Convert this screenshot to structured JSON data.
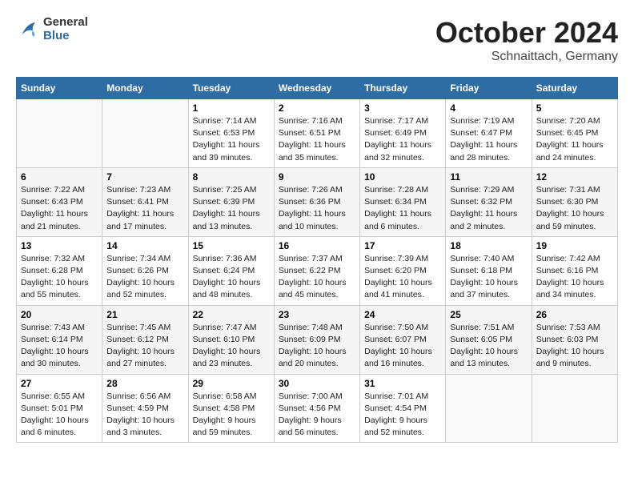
{
  "header": {
    "logo_line1": "General",
    "logo_line2": "Blue",
    "title": "October 2024",
    "subtitle": "Schnaittach, Germany"
  },
  "days_of_week": [
    "Sunday",
    "Monday",
    "Tuesday",
    "Wednesday",
    "Thursday",
    "Friday",
    "Saturday"
  ],
  "weeks": [
    {
      "days": [
        {
          "num": "",
          "info": ""
        },
        {
          "num": "",
          "info": ""
        },
        {
          "num": "1",
          "info": "Sunrise: 7:14 AM\nSunset: 6:53 PM\nDaylight: 11 hours\nand 39 minutes."
        },
        {
          "num": "2",
          "info": "Sunrise: 7:16 AM\nSunset: 6:51 PM\nDaylight: 11 hours\nand 35 minutes."
        },
        {
          "num": "3",
          "info": "Sunrise: 7:17 AM\nSunset: 6:49 PM\nDaylight: 11 hours\nand 32 minutes."
        },
        {
          "num": "4",
          "info": "Sunrise: 7:19 AM\nSunset: 6:47 PM\nDaylight: 11 hours\nand 28 minutes."
        },
        {
          "num": "5",
          "info": "Sunrise: 7:20 AM\nSunset: 6:45 PM\nDaylight: 11 hours\nand 24 minutes."
        }
      ]
    },
    {
      "days": [
        {
          "num": "6",
          "info": "Sunrise: 7:22 AM\nSunset: 6:43 PM\nDaylight: 11 hours\nand 21 minutes."
        },
        {
          "num": "7",
          "info": "Sunrise: 7:23 AM\nSunset: 6:41 PM\nDaylight: 11 hours\nand 17 minutes."
        },
        {
          "num": "8",
          "info": "Sunrise: 7:25 AM\nSunset: 6:39 PM\nDaylight: 11 hours\nand 13 minutes."
        },
        {
          "num": "9",
          "info": "Sunrise: 7:26 AM\nSunset: 6:36 PM\nDaylight: 11 hours\nand 10 minutes."
        },
        {
          "num": "10",
          "info": "Sunrise: 7:28 AM\nSunset: 6:34 PM\nDaylight: 11 hours\nand 6 minutes."
        },
        {
          "num": "11",
          "info": "Sunrise: 7:29 AM\nSunset: 6:32 PM\nDaylight: 11 hours\nand 2 minutes."
        },
        {
          "num": "12",
          "info": "Sunrise: 7:31 AM\nSunset: 6:30 PM\nDaylight: 10 hours\nand 59 minutes."
        }
      ]
    },
    {
      "days": [
        {
          "num": "13",
          "info": "Sunrise: 7:32 AM\nSunset: 6:28 PM\nDaylight: 10 hours\nand 55 minutes."
        },
        {
          "num": "14",
          "info": "Sunrise: 7:34 AM\nSunset: 6:26 PM\nDaylight: 10 hours\nand 52 minutes."
        },
        {
          "num": "15",
          "info": "Sunrise: 7:36 AM\nSunset: 6:24 PM\nDaylight: 10 hours\nand 48 minutes."
        },
        {
          "num": "16",
          "info": "Sunrise: 7:37 AM\nSunset: 6:22 PM\nDaylight: 10 hours\nand 45 minutes."
        },
        {
          "num": "17",
          "info": "Sunrise: 7:39 AM\nSunset: 6:20 PM\nDaylight: 10 hours\nand 41 minutes."
        },
        {
          "num": "18",
          "info": "Sunrise: 7:40 AM\nSunset: 6:18 PM\nDaylight: 10 hours\nand 37 minutes."
        },
        {
          "num": "19",
          "info": "Sunrise: 7:42 AM\nSunset: 6:16 PM\nDaylight: 10 hours\nand 34 minutes."
        }
      ]
    },
    {
      "days": [
        {
          "num": "20",
          "info": "Sunrise: 7:43 AM\nSunset: 6:14 PM\nDaylight: 10 hours\nand 30 minutes."
        },
        {
          "num": "21",
          "info": "Sunrise: 7:45 AM\nSunset: 6:12 PM\nDaylight: 10 hours\nand 27 minutes."
        },
        {
          "num": "22",
          "info": "Sunrise: 7:47 AM\nSunset: 6:10 PM\nDaylight: 10 hours\nand 23 minutes."
        },
        {
          "num": "23",
          "info": "Sunrise: 7:48 AM\nSunset: 6:09 PM\nDaylight: 10 hours\nand 20 minutes."
        },
        {
          "num": "24",
          "info": "Sunrise: 7:50 AM\nSunset: 6:07 PM\nDaylight: 10 hours\nand 16 minutes."
        },
        {
          "num": "25",
          "info": "Sunrise: 7:51 AM\nSunset: 6:05 PM\nDaylight: 10 hours\nand 13 minutes."
        },
        {
          "num": "26",
          "info": "Sunrise: 7:53 AM\nSunset: 6:03 PM\nDaylight: 10 hours\nand 9 minutes."
        }
      ]
    },
    {
      "days": [
        {
          "num": "27",
          "info": "Sunrise: 6:55 AM\nSunset: 5:01 PM\nDaylight: 10 hours\nand 6 minutes."
        },
        {
          "num": "28",
          "info": "Sunrise: 6:56 AM\nSunset: 4:59 PM\nDaylight: 10 hours\nand 3 minutes."
        },
        {
          "num": "29",
          "info": "Sunrise: 6:58 AM\nSunset: 4:58 PM\nDaylight: 9 hours\nand 59 minutes."
        },
        {
          "num": "30",
          "info": "Sunrise: 7:00 AM\nSunset: 4:56 PM\nDaylight: 9 hours\nand 56 minutes."
        },
        {
          "num": "31",
          "info": "Sunrise: 7:01 AM\nSunset: 4:54 PM\nDaylight: 9 hours\nand 52 minutes."
        },
        {
          "num": "",
          "info": ""
        },
        {
          "num": "",
          "info": ""
        }
      ]
    }
  ]
}
